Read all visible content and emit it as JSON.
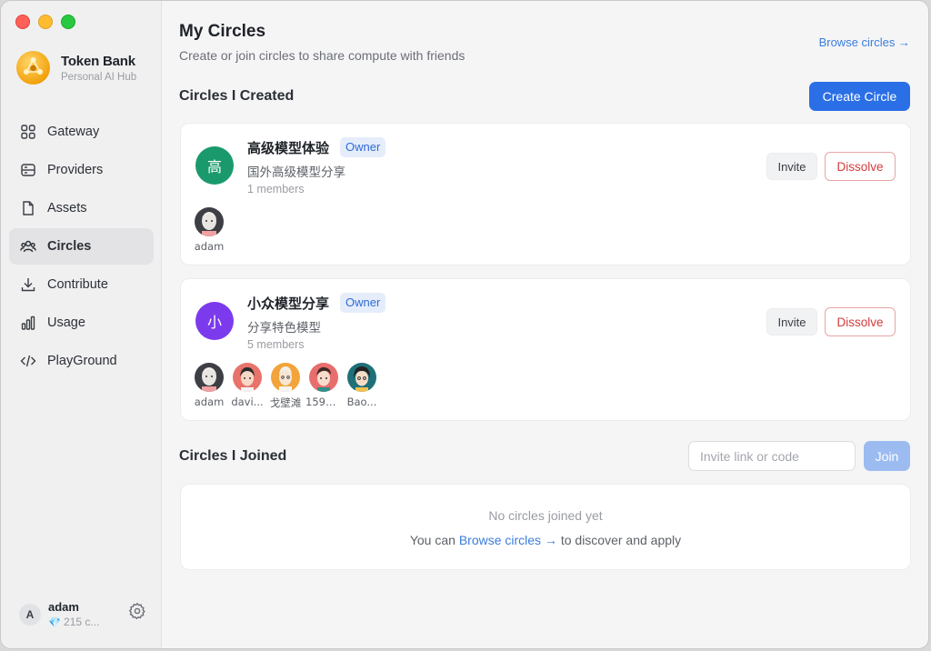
{
  "app": {
    "brand_name": "Token Bank",
    "brand_sub": "Personal AI Hub"
  },
  "sidebar": {
    "items": [
      {
        "label": "Gateway",
        "icon": "grid-icon"
      },
      {
        "label": "Providers",
        "icon": "server-icon"
      },
      {
        "label": "Assets",
        "icon": "document-icon"
      },
      {
        "label": "Circles",
        "icon": "users-icon",
        "active": true
      },
      {
        "label": "Contribute",
        "icon": "download-icon"
      },
      {
        "label": "Usage",
        "icon": "bar-chart-icon"
      },
      {
        "label": "PlayGround",
        "icon": "code-icon"
      }
    ],
    "user": {
      "initial": "A",
      "name": "adam",
      "credits": "215 c..."
    }
  },
  "header": {
    "title": "My Circles",
    "subtitle": "Create or join circles to share compute with friends",
    "browse_link": "Browse circles →"
  },
  "created": {
    "section_title": "Circles I Created",
    "create_label": "Create Circle",
    "circles": [
      {
        "avatar_char": "高",
        "avatar_color": "#1a9a6c",
        "name": "高级模型体验",
        "badge": "Owner",
        "desc": "国外高级模型分享",
        "members_text": "1 members",
        "invite_label": "Invite",
        "dissolve_label": "Dissolve",
        "members": [
          {
            "name": "adam"
          }
        ]
      },
      {
        "avatar_char": "小",
        "avatar_color": "#7c3aed",
        "name": "小众模型分享",
        "badge": "Owner",
        "desc": "分享特色模型",
        "members_text": "5 members",
        "invite_label": "Invite",
        "dissolve_label": "Dissolve",
        "members": [
          {
            "name": "adam"
          },
          {
            "name": "davi..."
          },
          {
            "name": "戈壁滩"
          },
          {
            "name": "1597..."
          },
          {
            "name": "Bao..."
          }
        ]
      }
    ]
  },
  "joined": {
    "section_title": "Circles I Joined",
    "input_placeholder": "Invite link or code",
    "join_label": "Join",
    "empty_title": "No circles joined yet",
    "empty_prefix": "You can",
    "empty_link": "Browse circles →",
    "empty_suffix": "to discover and apply"
  },
  "colors": {
    "accent": "#2a6fe6",
    "owner_badge_bg": "#e5edfb",
    "danger": "#d33b3b"
  }
}
